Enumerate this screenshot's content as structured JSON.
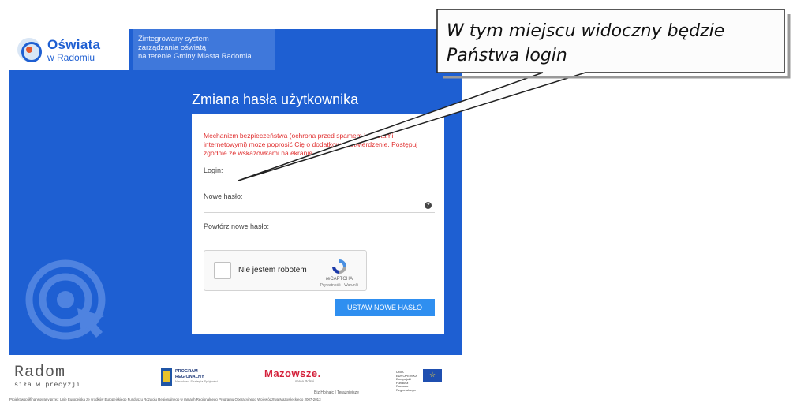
{
  "header": {
    "logo_title": "Oświata",
    "logo_subtitle": "w Radomiu",
    "tagline_lines": [
      "Zintegrowany system",
      "zarządzania oświatą",
      "na terenie Gminy Miasta Radomia"
    ]
  },
  "form": {
    "title": "Zmiana hasła użytkownika",
    "security_note": "Mechanizm bezpieczeństwa (ochrona przed spamem i robotami internetowymi) może poprosić Cię o dodatkowe potwierdzenie. Postępuj zgodnie ze wskazówkami na ekranie.",
    "login_label": "Login:",
    "new_password_label": "Nowe hasło:",
    "repeat_password_label": "Powtórz nowe hasło:",
    "help_icon": "?",
    "captcha": {
      "label": "Nie jestem robotem",
      "brand": "reCAPTCHA",
      "links": "Prywatność - Warunki"
    },
    "submit_label": "USTAW NOWE HASŁO"
  },
  "callout": {
    "lines": [
      "W tym miejscu widoczny będzie",
      "Państwa login"
    ]
  },
  "footer": {
    "radom_word": "Radom",
    "radom_tag": "siła w precyzji",
    "pr_lines": [
      "PROGRAM",
      "REGIONALNY"
    ],
    "pr_sub": "Narodowa Strategia Spójności",
    "mazowsze": "Mazowsze.",
    "mazowsze_sub": "serce Polski",
    "eu_text": "UNIA EUROPEJSKA Europejski Fundusz Rozwoju Regionalnego",
    "contact": "Biz Hojnaic I Teraźniejsze",
    "eu_line": "Projekt współfinansowany przez Unię Europejską ze środków Europejskiego Funduszu Rozwoju Regionalnego w ramach Regionalnego Programu Operacyjnego Województwa Mazowieckiego 2007-2013"
  },
  "colors": {
    "panel_blue": "#1e5fd2",
    "note_red": "#e03030",
    "button_blue": "#2f8ff0"
  }
}
